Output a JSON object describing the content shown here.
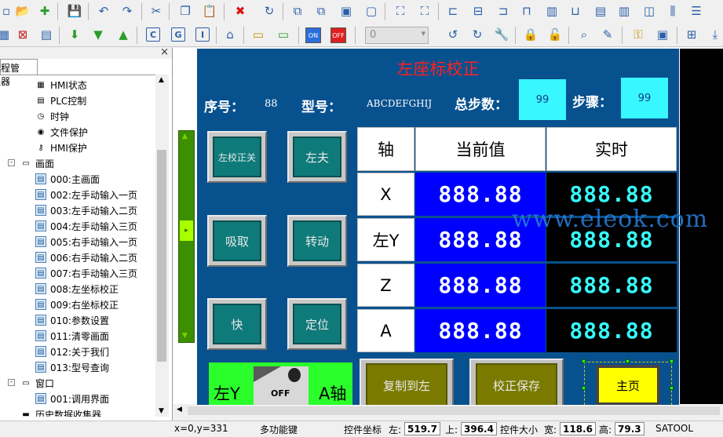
{
  "toolbar": {
    "row1_icons": [
      "new-icon",
      "open-icon",
      "add-icon",
      "save-icon",
      "undo-icon",
      "redo-icon",
      "cut-icon",
      "copy-icon",
      "paste-icon",
      "delete-icon",
      "refresh-icon",
      "front-icon",
      "back-icon",
      "group-icon",
      "ungroup-icon",
      "select-icon",
      "fit-icon",
      "align-left-icon",
      "align-center-icon",
      "align-right-icon",
      "align-top-icon",
      "align-middle-icon",
      "align-bottom-icon",
      "same-width-icon",
      "same-height-icon",
      "hspace-icon",
      "vspace-icon",
      "center-icon"
    ],
    "row2_icons": [
      "compile-icon",
      "delete-record-icon",
      "download-icon",
      "upload-icon",
      "sim-icon",
      "c-icon",
      "g-icon",
      "info-icon",
      "properties-icon",
      "screen-icon",
      "new-screen-icon",
      "on-state-icon",
      "off-state-icon",
      "prev-screen-icon",
      "next-screen-icon",
      "tools-icon",
      "lock-icon",
      "unlock-icon",
      "find-icon",
      "settings-icon",
      "key-icon",
      "export-icon",
      "window-icon",
      "download-arrow-icon"
    ],
    "on_label": "ON",
    "off_label": "OFF",
    "state_value": "0",
    "on_color": "#2a6fdb",
    "off_color": "#e02020"
  },
  "panel": {
    "tab_label": "工程管理器",
    "close": "×",
    "tree": [
      {
        "label": "HMI状态",
        "icon": "hmi-status-icon",
        "level": 2
      },
      {
        "label": "PLC控制",
        "icon": "plc-control-icon",
        "level": 2
      },
      {
        "label": "时钟",
        "icon": "clock-icon",
        "level": 2
      },
      {
        "label": "文件保护",
        "icon": "file-protect-icon",
        "level": 2
      },
      {
        "label": "HMI保护",
        "icon": "key-icon",
        "level": 2
      },
      {
        "label": "画面",
        "icon": "screen-icon",
        "level": 1,
        "expander": "-"
      },
      {
        "label": "000:主画面",
        "icon": "page-icon",
        "level": 2
      },
      {
        "label": "002:左手动输入一页",
        "icon": "page-icon",
        "level": 2
      },
      {
        "label": "003:左手动输入二页",
        "icon": "page-icon",
        "level": 2
      },
      {
        "label": "004:左手动输入三页",
        "icon": "page-icon",
        "level": 2
      },
      {
        "label": "005:右手动输入一页",
        "icon": "page-icon",
        "level": 2
      },
      {
        "label": "006:右手动输入二页",
        "icon": "page-icon",
        "level": 2
      },
      {
        "label": "007:右手动输入三页",
        "icon": "page-icon",
        "level": 2
      },
      {
        "label": "008:左坐标校正",
        "icon": "page-icon",
        "level": 2
      },
      {
        "label": "009:右坐标校正",
        "icon": "page-icon",
        "level": 2
      },
      {
        "label": "010:参数设置",
        "icon": "page-icon",
        "level": 2
      },
      {
        "label": "011:清零画面",
        "icon": "page-icon",
        "level": 2
      },
      {
        "label": "012:关于我们",
        "icon": "page-icon",
        "level": 2
      },
      {
        "label": "013:型号查询",
        "icon": "page-icon",
        "level": 2
      },
      {
        "label": "窗口",
        "icon": "window-icon",
        "level": 1,
        "expander": "-"
      },
      {
        "label": "001:调用界面",
        "icon": "page-icon",
        "level": 2
      },
      {
        "label": "历史数据收集器",
        "icon": "disk-icon",
        "level": 1
      }
    ]
  },
  "hmi": {
    "title": "左座标校正",
    "serial_label": "序号：",
    "serial_value": "88",
    "model_label": "型号：",
    "model_value": "ABCDEFGHIJ",
    "total_steps_label": "总步数：",
    "total_steps_value": "99",
    "step_label": "步骤：",
    "step_value": "99",
    "buttons": {
      "left_calib_off": "左校正关",
      "left_clamp": "左夫",
      "suction": "吸取",
      "rotate": "转动",
      "fast": "快",
      "position": "定位",
      "copy_to_left": "复制到左",
      "save_calib": "校正保存",
      "home": "主页"
    },
    "table": {
      "headers": [
        "轴",
        "当前值",
        "实时"
      ],
      "rows": [
        {
          "axis": "X",
          "current": "888.88",
          "realtime": "888.88"
        },
        {
          "axis": "左Y",
          "current": "888.88",
          "realtime": "888.88"
        },
        {
          "axis": "Z",
          "current": "888.88",
          "realtime": "888.88"
        },
        {
          "axis": "A",
          "current": "888.88",
          "realtime": "888.88"
        }
      ]
    },
    "switch": {
      "left_label": "左Y",
      "state_label": "OFF",
      "right_label": "A轴"
    },
    "watermark": "www.eleok.com"
  },
  "status": {
    "coords": "x=0,y=331",
    "mode": "多功能键",
    "ctrl_coords_label": "控件坐标",
    "left_label": "左:",
    "left_value": "519.7",
    "top_label": "上:",
    "top_value": "396.4",
    "ctrl_size_label": "控件大小",
    "width_label": "宽:",
    "width_value": "118.6",
    "height_label": "高:",
    "height_value": "79.3",
    "app": "SATOOL"
  }
}
